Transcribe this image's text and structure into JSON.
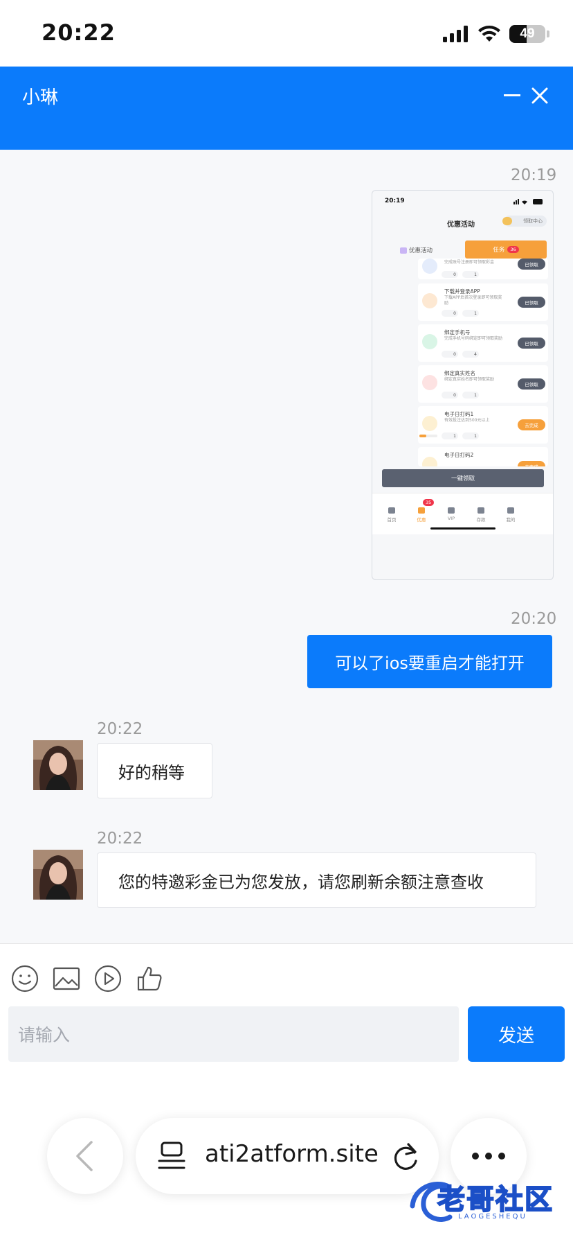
{
  "status_bar": {
    "time": "20:22",
    "battery": "49",
    "battery_level_pct": 49
  },
  "header": {
    "title": "小琳"
  },
  "messages": [
    {
      "time": "20:19"
    },
    {
      "time": "20:20",
      "text": "可以了ios要重启才能打开"
    },
    {
      "time": "20:22",
      "text": "好的稍等"
    },
    {
      "time": "20:22",
      "text": "您的特邀彩金已为您发放，请您刷新余额注意查收"
    }
  ],
  "shared_screenshot": {
    "time": "20:19",
    "title": "优惠活动",
    "claim_center": "领取中心",
    "tab_promo": "优惠活动",
    "tab_tasks": "任务",
    "tab_tasks_badge": "36",
    "tasks": [
      {
        "title": "",
        "desc": "完成账号注册即可领取彩金",
        "coins": "0",
        "points": "1",
        "button": "已领取"
      },
      {
        "title": "下载并登录APP",
        "desc": "下载APP后首次登录即可领取奖励",
        "coins": "0",
        "points": "1",
        "button": "已领取"
      },
      {
        "title": "绑定手机号",
        "desc": "完成手机号码绑定即可领取奖励",
        "coins": "0",
        "points": "4",
        "button": "已领取"
      },
      {
        "title": "绑定真实姓名",
        "desc": "绑定真实姓名即可领取奖励",
        "coins": "0",
        "points": "1",
        "button": "已领取"
      },
      {
        "title": "电子日打码1",
        "desc": "有效投注达到500元以上",
        "coins": "1",
        "points": "1",
        "button": "去完成"
      },
      {
        "title": "电子日打码2",
        "desc": "",
        "coins": "",
        "points": "",
        "button": "去完成"
      }
    ],
    "claim_all": "一键领取",
    "nav": [
      {
        "label": "首页"
      },
      {
        "label": "优惠",
        "badge": "35"
      },
      {
        "label": "VIP"
      },
      {
        "label": "存款"
      },
      {
        "label": "我的"
      }
    ]
  },
  "composer": {
    "placeholder": "请输入",
    "send_label": "发送",
    "tools": [
      "emoji-icon",
      "image-icon",
      "video-icon",
      "thumbs-up-icon"
    ]
  },
  "browser": {
    "url": "ati2atform.site"
  },
  "watermark": {
    "text": "老哥社区",
    "subtext": "LAOGESHEQU"
  },
  "colors": {
    "accent": "#0b7bfb",
    "task_orange": "#f6a03b"
  }
}
